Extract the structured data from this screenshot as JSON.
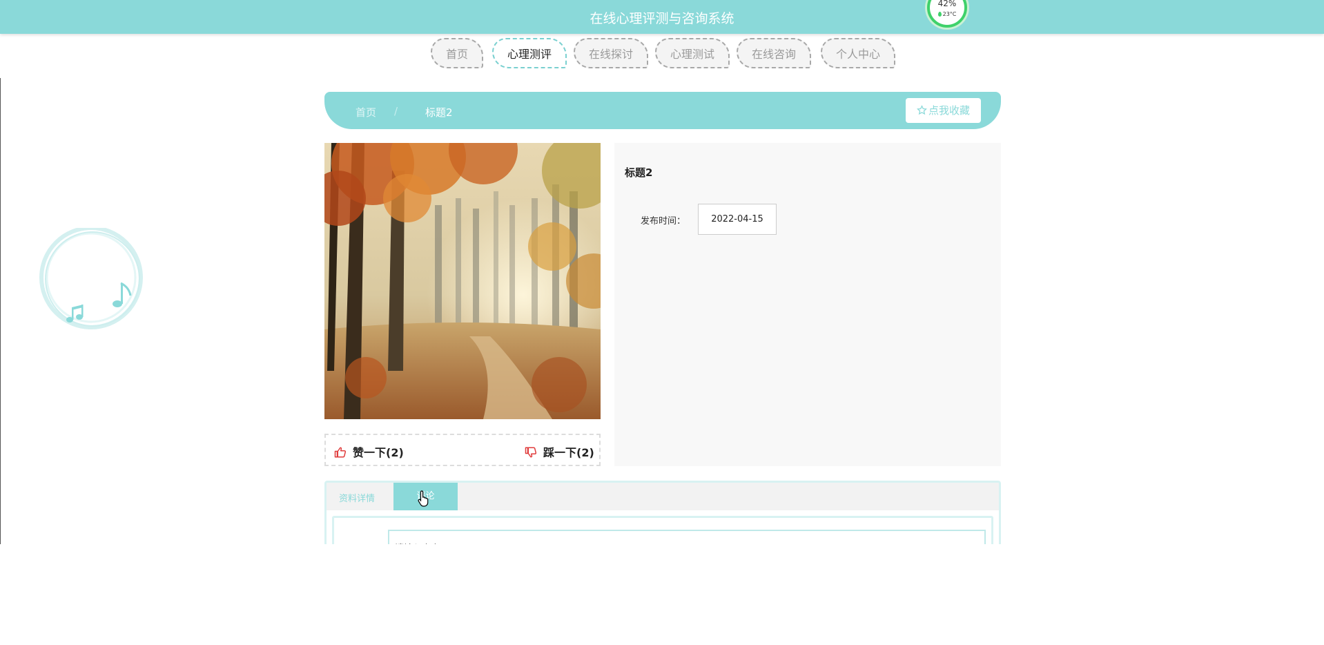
{
  "header": {
    "title": "在线心理评测与咨询系统",
    "widget": {
      "percent": "42%",
      "temperature": "23°C",
      "accent": "#3fd16a"
    }
  },
  "nav": {
    "items": [
      {
        "label": "首页",
        "active": false
      },
      {
        "label": "心理测评",
        "active": true
      },
      {
        "label": "在线探讨",
        "active": false
      },
      {
        "label": "心理测试",
        "active": false
      },
      {
        "label": "在线咨询",
        "active": false
      },
      {
        "label": "个人中心",
        "active": false
      }
    ]
  },
  "breadcrumb": {
    "home": "首页",
    "separator": "/",
    "current": "标题2"
  },
  "favorite": {
    "label": "点我收藏",
    "icon": "star-outline-icon"
  },
  "detail": {
    "title": "标题2",
    "publish_label": "发布时间：",
    "publish_date": "2022-04-15",
    "image_subject": "autumn-forest-path"
  },
  "votes": {
    "like": {
      "label": "赞一下(2)",
      "icon": "thumbs-up-icon"
    },
    "dislike": {
      "label": "踩一下(2)",
      "icon": "thumbs-down-icon"
    }
  },
  "tabs": {
    "items": [
      {
        "label": "资料详情",
        "active": false
      },
      {
        "label": "评论",
        "active": true
      }
    ]
  },
  "comment": {
    "placeholder": "请输入内容"
  },
  "theme": {
    "primary": "#8ad9d9",
    "icon_red": "#e03b3b"
  }
}
